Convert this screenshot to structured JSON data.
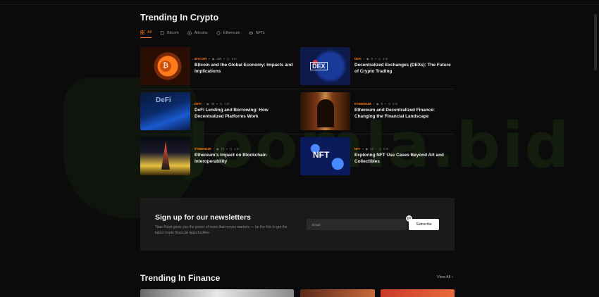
{
  "watermark": {
    "text": "Joomla.bid"
  },
  "crypto": {
    "title": "Trending In Crypto",
    "tabs": [
      {
        "label": "All",
        "icon": "grid-icon",
        "active": true
      },
      {
        "label": "Bitcoin",
        "icon": "bitcoin-icon",
        "active": false
      },
      {
        "label": "Altcoins",
        "icon": "coin-icon",
        "active": false
      },
      {
        "label": "Ethereum",
        "icon": "ethereum-icon",
        "active": false
      },
      {
        "label": "NFTs",
        "icon": "nft-icon",
        "active": false
      }
    ],
    "articles": [
      {
        "category": "BITCOIN",
        "views": "300",
        "read": "3 m",
        "title": "Bitcoin and the Global Economy: Impacts and Implications",
        "thumb_color": "#3a1a0a",
        "thumb_accent": "#ff7a1a"
      },
      {
        "category": "DEFI",
        "views": "6",
        "read": "1 m",
        "title": "Decentralized Exchanges (DEXs): The Future of Crypto Trading",
        "thumb_color": "#0d1a4a",
        "thumb_accent": "#d83040"
      },
      {
        "category": "DEFI",
        "views": "16",
        "read": "1 m",
        "title": "DeFi Lending and Borrowing: How Decentralized Platforms Work",
        "thumb_color": "#0a2a6a",
        "thumb_accent": "#3a7ae0"
      },
      {
        "category": "ETHEREUM",
        "views": "5",
        "read": "2 m",
        "title": "Ethereum and Decentralized Finance: Changing the Financial Landscape",
        "thumb_color": "#3a1a0a",
        "thumb_accent": "#c98a4a"
      },
      {
        "category": "ETHEREUM",
        "views": "17",
        "read": "1 m",
        "title": "Ethereum's Impact on Blockchain Interoperability",
        "thumb_color": "#1a1a2a",
        "thumb_accent": "#e8c040"
      },
      {
        "category": "NFT",
        "views": "12",
        "read": "0 m",
        "title": "Exploring NFT Use Cases Beyond Art and Collectibles",
        "thumb_color": "#0a1a5a",
        "thumb_accent": "#4a8aff"
      }
    ]
  },
  "newsletter": {
    "title": "Sign up for our newsletters",
    "description": "Titan Flash gives you the power of news that moves markets — be the first to get the latest crypto financial opportunities",
    "email_placeholder": "Email",
    "button_label": "Subscribe"
  },
  "finance": {
    "title": "Trending In Finance",
    "view_all": "View All"
  },
  "colors": {
    "accent": "#ff7a1a",
    "background": "#0b0b0b",
    "panel": "#1a1a1a"
  }
}
